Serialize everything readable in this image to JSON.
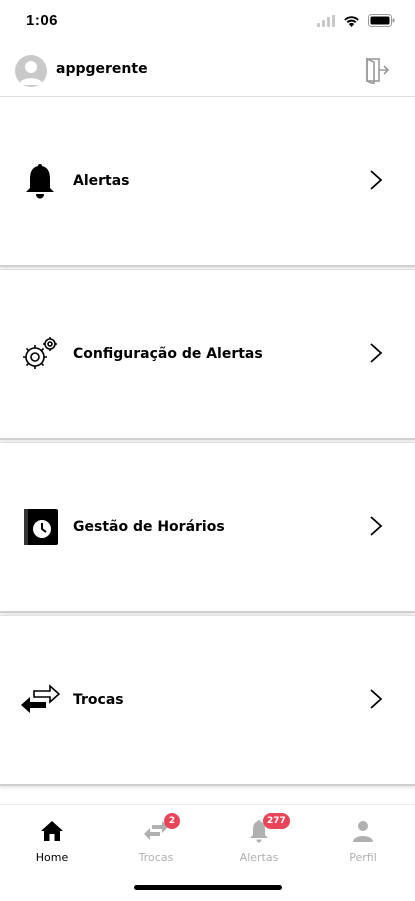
{
  "status_bar": {
    "time": "1:06"
  },
  "header": {
    "username": "appgerente"
  },
  "menu": [
    {
      "label": "Alertas",
      "icon": "bell-icon"
    },
    {
      "label": "Configuração de Alertas",
      "icon": "gears-icon"
    },
    {
      "label": "Gestão de Horários",
      "icon": "clock-book-icon"
    },
    {
      "label": "Trocas",
      "icon": "swap-arrows-icon"
    }
  ],
  "tabbar": {
    "tabs": [
      {
        "label": "Home",
        "icon": "home-icon",
        "active": true
      },
      {
        "label": "Trocas",
        "icon": "swap-icon",
        "badge": "2"
      },
      {
        "label": "Alertas",
        "icon": "bell-icon",
        "badge": "277"
      },
      {
        "label": "Perfil",
        "icon": "person-icon"
      }
    ]
  },
  "colors": {
    "badge": "#e8445a",
    "inactive": "#b0b0b0",
    "active": "#000000"
  }
}
